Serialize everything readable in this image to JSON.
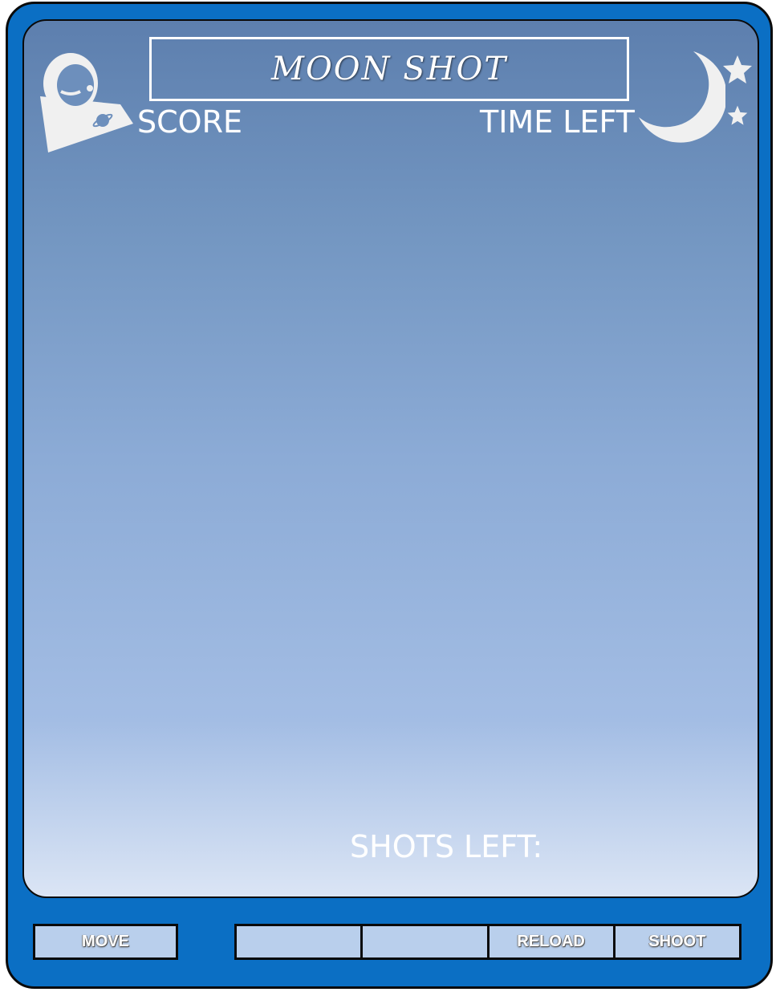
{
  "game": {
    "title": "MOON SHOT",
    "score_label": "SCORE",
    "time_left_label": "TIME LEFT",
    "shots_left_label": "SHOTS LEFT:"
  },
  "controls": {
    "move_label": "MOVE",
    "slot1_label": "",
    "slot2_label": "",
    "reload_label": "RELOAD",
    "shoot_label": "SHOOT"
  },
  "icons": {
    "astronaut": "astronaut-icon",
    "moon": "crescent-moon-icon",
    "star": "star-icon"
  },
  "colors": {
    "device_frame": "#0b6fc4",
    "screen_top": "#5d7fae",
    "screen_bottom": "#dbe5f5",
    "button_fill": "#b9cfec",
    "text": "#ffffff"
  }
}
